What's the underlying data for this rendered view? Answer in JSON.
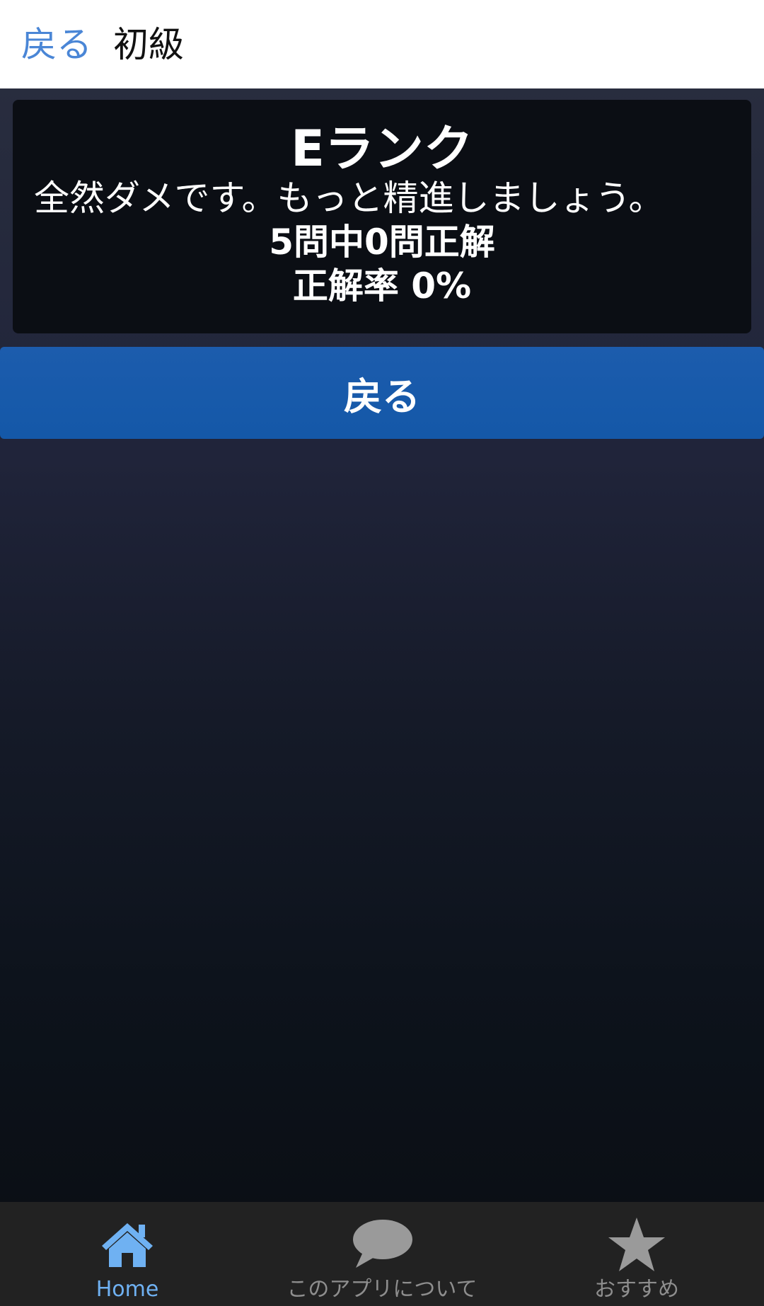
{
  "navbar": {
    "back_label": "戻る",
    "title": "初級"
  },
  "result": {
    "rank": "Eランク",
    "comment": "全然ダメです。もっと精進しましょう。",
    "score": "5問中0問正解",
    "rate": "正解率 0%"
  },
  "back_button": {
    "label": "戻る"
  },
  "tabbar": {
    "tabs": [
      {
        "label": "Home",
        "icon": "home-icon",
        "active": true
      },
      {
        "label": "このアプリについて",
        "icon": "speech-bubble-icon",
        "active": false
      },
      {
        "label": "おすすめ",
        "icon": "star-icon",
        "active": false
      }
    ]
  },
  "colors": {
    "accent": "#4a86d6",
    "button": "#1458a8",
    "tab_active": "#6fb1f2",
    "tab_inactive": "#8e8e8e",
    "tabbar_bg": "#222222",
    "card_bg": "#0b0e14"
  }
}
